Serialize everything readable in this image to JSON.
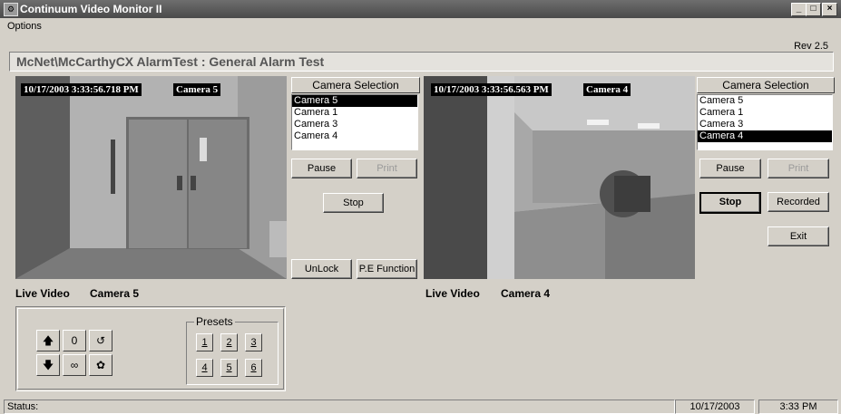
{
  "window": {
    "title": "Continuum Video Monitor II",
    "minimize": "_",
    "maximize": "□",
    "close": "×"
  },
  "menu": {
    "options": "Options"
  },
  "rev": "Rev 2.5",
  "alarm_title": "McNet\\McCarthyCX AlarmTest : General Alarm Test",
  "left": {
    "timestamp": "10/17/2003  3:33:56.718 PM",
    "camera_overlay": "Camera 5",
    "selection_header": "Camera Selection",
    "cameras": [
      "Camera 5",
      "Camera 1",
      "Camera 3",
      "Camera 4"
    ],
    "selected_index": 0,
    "pause": "Pause",
    "print": "Print",
    "stop": "Stop",
    "unlock": "UnLock",
    "pe_function": "P.E Function",
    "live_label": "Live Video",
    "camera_label": "Camera 5"
  },
  "right": {
    "timestamp": "10/17/2003  3:33:56.563 PM",
    "camera_overlay": "Camera 4",
    "selection_header": "Camera Selection",
    "cameras": [
      "Camera 5",
      "Camera 1",
      "Camera 3",
      "Camera 4"
    ],
    "selected_index": 3,
    "pause": "Pause",
    "print": "Print",
    "stop": "Stop",
    "recorded": "Recorded",
    "exit": "Exit",
    "live_label": "Live Video",
    "camera_label": "Camera 4"
  },
  "ptz": {
    "up": "🡅",
    "zero": "0",
    "rotate_ccw": "↺",
    "down": "🡇",
    "infinity": "∞",
    "iris": "✿",
    "presets_label": "Presets",
    "presets": [
      "1",
      "2",
      "3",
      "4",
      "5",
      "6"
    ]
  },
  "status": {
    "label": "Status:",
    "date": "10/17/2003",
    "time": "3:33 PM"
  }
}
